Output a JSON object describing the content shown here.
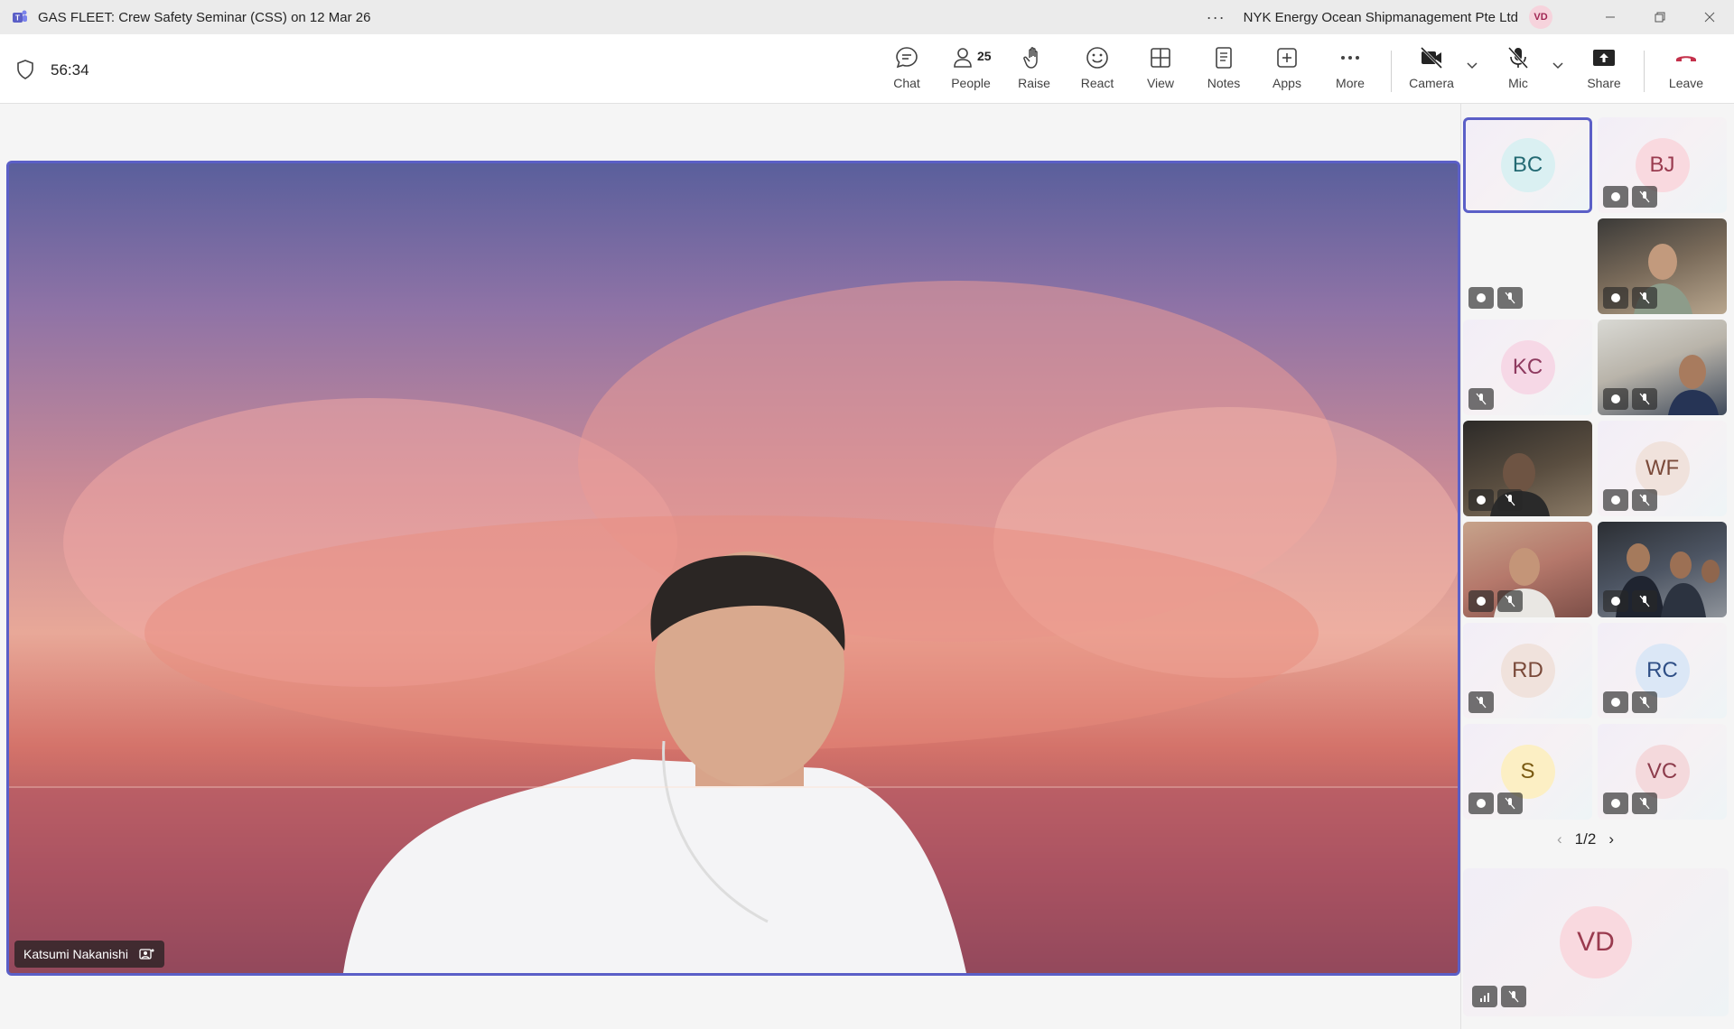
{
  "window": {
    "title": "GAS FLEET: Crew Safety Seminar (CSS) on 12 Mar 26",
    "org": "NYK Energy Ocean Shipmanagement Pte Ltd",
    "account_initials": "VD"
  },
  "toolbar": {
    "timer": "56:34",
    "people_count": "25",
    "items": [
      {
        "label": "Chat",
        "icon": "chat-icon"
      },
      {
        "label": "People",
        "icon": "people-icon"
      },
      {
        "label": "Raise",
        "icon": "raise-hand-icon"
      },
      {
        "label": "React",
        "icon": "react-icon"
      },
      {
        "label": "View",
        "icon": "view-icon"
      },
      {
        "label": "Notes",
        "icon": "notes-icon"
      },
      {
        "label": "Apps",
        "icon": "apps-icon"
      },
      {
        "label": "More",
        "icon": "more-icon"
      },
      {
        "label": "Camera",
        "icon": "camera-off-icon"
      },
      {
        "label": "Mic",
        "icon": "mic-off-icon"
      },
      {
        "label": "Share",
        "icon": "share-icon"
      },
      {
        "label": "Leave",
        "icon": "leave-icon"
      }
    ]
  },
  "stage": {
    "presenter_name": "Katsumi Nakanishi"
  },
  "gallery": {
    "tiles": [
      {
        "initials": "BC",
        "type": "avatar"
      },
      {
        "initials": "BJ",
        "type": "avatar"
      },
      {
        "initials": "",
        "type": "blank"
      },
      {
        "initials": "",
        "type": "video"
      },
      {
        "initials": "KC",
        "type": "avatar"
      },
      {
        "initials": "",
        "type": "video"
      },
      {
        "initials": "",
        "type": "video"
      },
      {
        "initials": "WF",
        "type": "avatar"
      },
      {
        "initials": "",
        "type": "video"
      },
      {
        "initials": "",
        "type": "video"
      },
      {
        "initials": "RD",
        "type": "avatar"
      },
      {
        "initials": "RC",
        "type": "avatar"
      },
      {
        "initials": "S",
        "type": "avatar"
      },
      {
        "initials": "VC",
        "type": "avatar"
      }
    ],
    "pager": "1/2",
    "self_initials": "VD"
  },
  "colors": {
    "accent": "#5b5fc7",
    "leave": "#c4314b"
  }
}
